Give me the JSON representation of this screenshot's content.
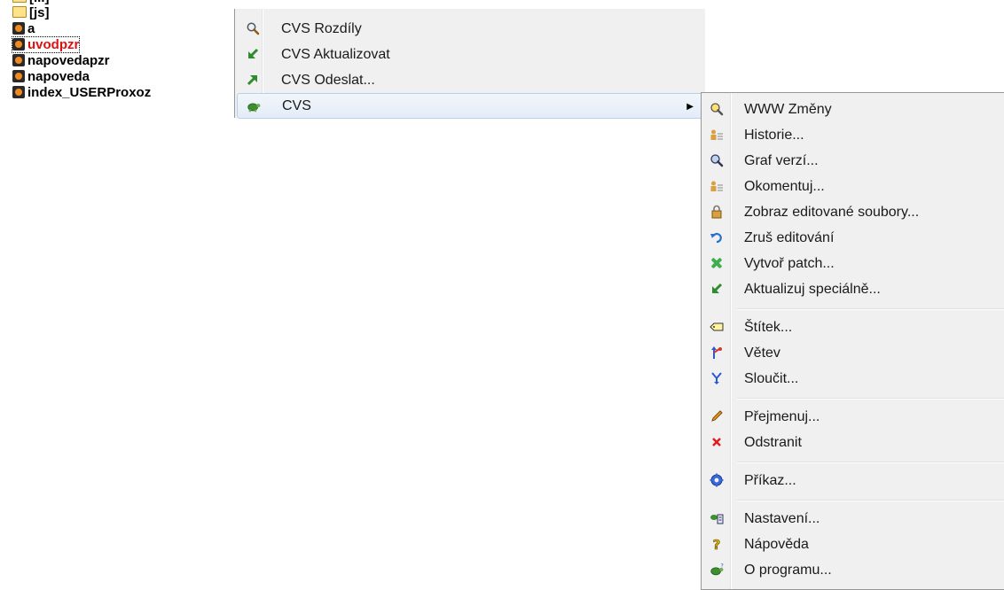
{
  "file_list": {
    "items": [
      {
        "name": "[js]",
        "icon": "folder-icon",
        "selected": false
      },
      {
        "name": "a",
        "icon": "document-icon",
        "selected": false
      },
      {
        "name": "uvodpzr",
        "icon": "document-icon",
        "selected": true
      },
      {
        "name": "napovedapzr",
        "icon": "document-icon",
        "selected": false
      },
      {
        "name": "napoveda",
        "icon": "document-icon",
        "selected": false
      },
      {
        "name": "index_USERProxoz",
        "icon": "document-icon",
        "selected": false
      }
    ]
  },
  "main_menu": {
    "items": [
      {
        "label": "CVS Rozdíly",
        "icon": "magnifier-icon"
      },
      {
        "label": "CVS Aktualizovat",
        "icon": "arrow-down-left-icon"
      },
      {
        "label": "CVS Odeslat...",
        "icon": "arrow-up-right-icon"
      },
      {
        "label": "CVS",
        "icon": "turtle-icon",
        "has_submenu": true
      }
    ]
  },
  "sub_menu": {
    "items": [
      {
        "label": "WWW Změny",
        "icon": "globe-magnifier-icon"
      },
      {
        "label": "Historie...",
        "icon": "history-icon"
      },
      {
        "label": "Graf verzí...",
        "icon": "graph-magnifier-icon"
      },
      {
        "label": "Okomentuj...",
        "icon": "annotate-icon"
      },
      {
        "label": "Zobraz editované soubory...",
        "icon": "lock-edit-icon"
      },
      {
        "label": "Zruš editování",
        "icon": "undo-icon"
      },
      {
        "label": "Vytvoř patch...",
        "icon": "patch-icon"
      },
      {
        "label": "Aktualizuj speciálně...",
        "icon": "arrow-down-left-icon"
      },
      {
        "label": "Štítek...",
        "icon": "tag-icon"
      },
      {
        "label": "Větev",
        "icon": "branch-icon"
      },
      {
        "label": "Sloučit...",
        "icon": "merge-icon"
      },
      {
        "label": "Přejmenuj...",
        "icon": "pencil-icon"
      },
      {
        "label": "Odstranit",
        "icon": "delete-x-icon"
      },
      {
        "label": "Příkaz...",
        "icon": "gear-icon"
      },
      {
        "label": "Nastavení...",
        "icon": "settings-icon"
      },
      {
        "label": "Nápověda",
        "icon": "help-icon"
      },
      {
        "label": "O programu...",
        "icon": "about-turtle-icon"
      }
    ]
  },
  "colors": {
    "selected_file_text": "#e01010",
    "menu_background": "#f0f0f0",
    "highlight_border": "#b7cfee"
  }
}
